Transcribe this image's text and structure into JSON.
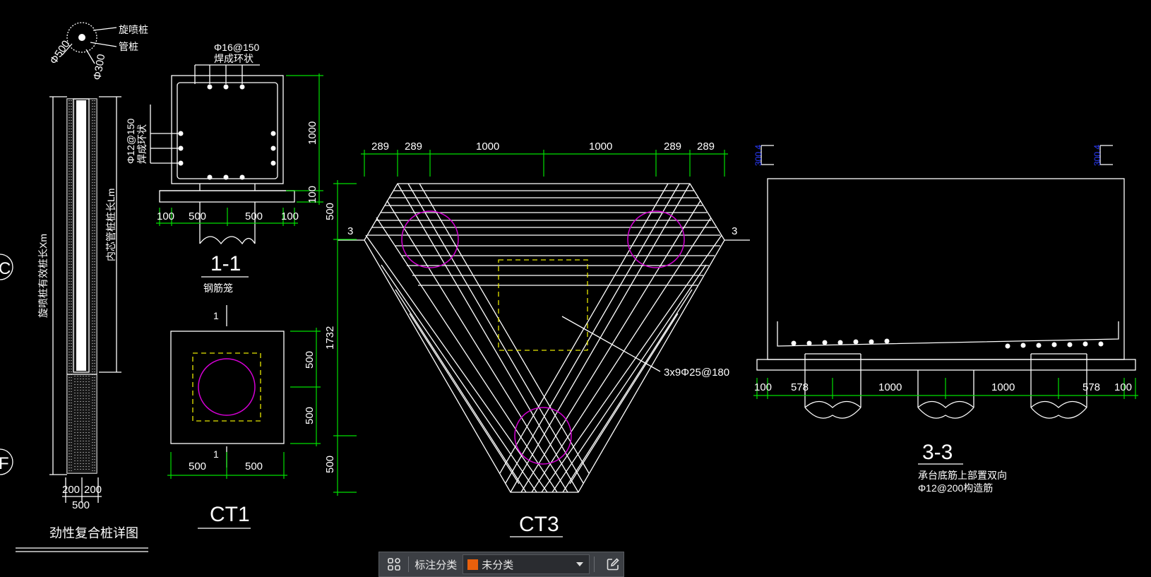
{
  "drawing": {
    "pile_detail": {
      "title": "劲性复合桩详图",
      "label_jet": "旋喷桩",
      "label_pipe": "管桩",
      "dim_outer_dia": "Φ500",
      "dim_inner_dia": "Φ300",
      "label_length_outer": "旋喷桩有效桩长Xm",
      "label_length_inner": "内芯管桩桩长Lm",
      "dim_200_left": "200",
      "dim_200_right": "200",
      "dim_500": "500"
    },
    "section_1_1": {
      "title": "1-1",
      "note": "钢筋笼",
      "top_rebar": "Φ16@150",
      "top_rebar_note": "焊成环状",
      "side_rebar": "Φ12@150",
      "side_rebar_note": "焊成环状",
      "dim_height": "1000",
      "dim_bottom": "100",
      "dims_bottom": [
        "100",
        "500",
        "500",
        "100"
      ]
    },
    "ct1": {
      "title": "CT1",
      "section_mark_top": "1",
      "section_mark_bottom": "1",
      "dims_right": [
        "500",
        "500"
      ],
      "dims_bottom": [
        "500",
        "500"
      ]
    },
    "ct3": {
      "title": "CT3",
      "dims_top": [
        "289",
        "289",
        "1000",
        "1000",
        "289",
        "289"
      ],
      "dims_left": [
        "500",
        "1732",
        "500"
      ],
      "rebar_note": "3x9Φ25@180",
      "section_mark_left": "3",
      "section_mark_right": "3"
    },
    "section_3_3": {
      "title": "3-3",
      "note_line1": "承台底筋上部置双向",
      "note_line2": "Φ12@200构造筋",
      "elev_left": "300.4",
      "elev_right": "300.4",
      "dims_bottom": [
        "100",
        "578",
        "1000",
        "1000",
        "578",
        "100"
      ]
    },
    "grid_labels": [
      "C",
      "F"
    ]
  },
  "toolbar": {
    "label": "标注分类",
    "selected": "未分类",
    "swatch_color": "#e8600c",
    "icon_left": "grid-icon",
    "icon_right": "edit-icon"
  }
}
